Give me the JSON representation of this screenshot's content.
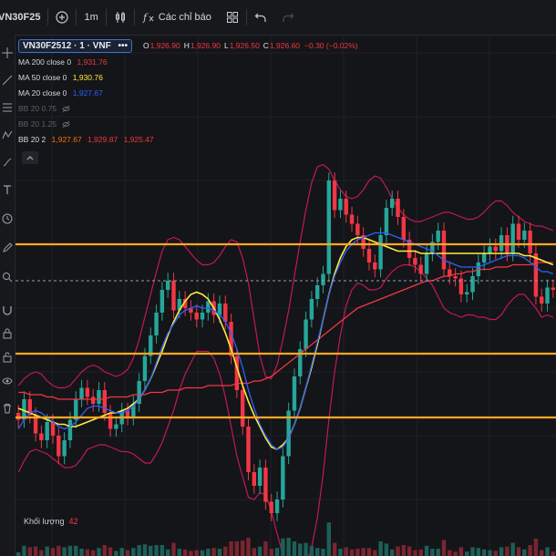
{
  "toolbar": {
    "symbol": "VN30F25",
    "interval": "1m",
    "indicators_label": "Các chỉ báo"
  },
  "legend": {
    "symbol_box": "VN30F2512 · 1 · VNF",
    "more": "•••",
    "ohlc": {
      "o_label": "O",
      "o": "1,926.90",
      "h_label": "H",
      "h": "1,926.90",
      "l_label": "L",
      "l": "1,926.50",
      "c_label": "C",
      "c": "1,926.60",
      "change": "−0.30 (−0.02%)"
    },
    "indicators": [
      {
        "label": "MA 200 close 0",
        "value": "1,931.76",
        "color": "#f23645",
        "dim": false
      },
      {
        "label": "MA 50 close 0",
        "value": "1,930.76",
        "color": "#ffeb3b",
        "dim": false
      },
      {
        "label": "MA 20 close 0",
        "value": "1,927.67",
        "color": "#2962ff",
        "dim": false
      },
      {
        "label": "BB 20 0.75",
        "value": "",
        "color": "",
        "dim": true
      },
      {
        "label": "BB 20 1.25",
        "value": "",
        "color": "",
        "dim": true
      }
    ],
    "bb_main": {
      "label": "BB 20 2",
      "v1": "1,927.67",
      "v2": "1,929.87",
      "v3": "1,925.47",
      "c1": "#ff6d00",
      "c2": "#f23645",
      "c3": "#f23645"
    }
  },
  "volume": {
    "label": "Khối lượng",
    "value": "42"
  },
  "colors": {
    "up": "#26a69a",
    "down": "#f23645",
    "ma200": "#f23645",
    "ma50": "#ffeb3b",
    "ma20": "#2962ff",
    "bb": "#c2185b",
    "hline": "#ffa726",
    "accent": "#2962ff"
  },
  "chart_data": {
    "type": "line",
    "title": "",
    "price_range_estimate": [
      1919,
      1934
    ],
    "horizontal_lines": [
      1930.8,
      1926.0,
      1923.2
    ],
    "last_price_line": 1929.2,
    "hline_labels": [
      "",
      "",
      ""
    ],
    "close": [
      1923.1,
      1924.0,
      1923.3,
      1922.5,
      1922.2,
      1923.0,
      1922.4,
      1921.5,
      1922.2,
      1923.1,
      1924.0,
      1924.5,
      1924.1,
      1923.8,
      1924.4,
      1923.4,
      1922.7,
      1922.9,
      1923.5,
      1923.2,
      1923.8,
      1924.8,
      1925.9,
      1926.8,
      1927.8,
      1928.8,
      1929.2,
      1927.9,
      1928.4,
      1928.0,
      1927.8,
      1927.5,
      1927.8,
      1928.3,
      1927.7,
      1928.2,
      1927.4,
      1925.9,
      1924.4,
      1922.8,
      1920.8,
      1920.2,
      1921.0,
      1919.5,
      1919.0,
      1919.6,
      1921.5,
      1923.5,
      1925.0,
      1926.2,
      1927.5,
      1928.4,
      1929.0,
      1929.5,
      1933.6,
      1932.3,
      1932.8,
      1932.1,
      1931.7,
      1931.2,
      1930.6,
      1930.0,
      1929.7,
      1931.2,
      1932.4,
      1932.8,
      1932.0,
      1931.0,
      1930.2,
      1929.9,
      1929.5,
      1930.4,
      1930.9,
      1931.4,
      1929.7,
      1929.4,
      1929.3,
      1928.6,
      1928.7,
      1929.4,
      1930.0,
      1930.4,
      1930.7,
      1930.5,
      1931.2,
      1930.4,
      1931.7,
      1931.0,
      1931.4,
      1930.4,
      1928.5,
      1928.2,
      1928.9,
      1928.8
    ],
    "ma20": [
      1922.7,
      1923.1,
      1923.4,
      1923.5,
      1923.4,
      1923.2,
      1923.0,
      1922.8,
      1922.7,
      1922.8,
      1923.0,
      1923.3,
      1923.6,
      1923.7,
      1923.7,
      1923.6,
      1923.5,
      1923.4,
      1923.4,
      1923.5,
      1923.7,
      1924.0,
      1924.4,
      1924.9,
      1925.6,
      1926.3,
      1926.9,
      1927.3,
      1927.7,
      1927.9,
      1928.0,
      1928.1,
      1928.0,
      1928.0,
      1927.9,
      1927.7,
      1927.4,
      1926.9,
      1926.2,
      1925.4,
      1924.4,
      1923.6,
      1922.9,
      1922.4,
      1922.0,
      1921.8,
      1921.9,
      1922.3,
      1922.9,
      1923.6,
      1924.5,
      1925.5,
      1926.5,
      1927.5,
      1928.6,
      1929.4,
      1930.0,
      1930.5,
      1930.8,
      1931.0,
      1931.1,
      1931.2,
      1931.3,
      1931.3,
      1931.3,
      1931.2,
      1931.1,
      1931.0,
      1930.9,
      1930.8,
      1930.7,
      1930.6,
      1930.5,
      1930.3,
      1930.1,
      1930.0,
      1929.9,
      1929.8,
      1929.8,
      1929.8,
      1929.8,
      1929.9,
      1930.0,
      1930.1,
      1930.2,
      1930.3,
      1930.3,
      1930.3,
      1930.2,
      1930.0,
      1929.8,
      1929.6,
      1929.6,
      1929.5
    ],
    "ma50": [
      1923.6,
      1923.5,
      1923.4,
      1923.3,
      1923.2,
      1923.1,
      1923.0,
      1922.9,
      1922.9,
      1922.8,
      1922.8,
      1922.9,
      1923.0,
      1923.1,
      1923.2,
      1923.3,
      1923.4,
      1923.4,
      1923.5,
      1923.6,
      1923.8,
      1924.0,
      1924.4,
      1924.9,
      1925.5,
      1926.1,
      1926.8,
      1927.4,
      1927.9,
      1928.3,
      1928.6,
      1928.7,
      1928.6,
      1928.4,
      1928.0,
      1927.5,
      1926.9,
      1926.2,
      1925.4,
      1924.6,
      1923.9,
      1923.3,
      1922.8,
      1922.3,
      1921.9,
      1921.8,
      1922.0,
      1922.3,
      1922.9,
      1923.6,
      1924.5,
      1925.4,
      1926.4,
      1927.5,
      1928.6,
      1929.5,
      1930.2,
      1930.7,
      1931.0,
      1931.1,
      1931.1,
      1931.0,
      1930.9,
      1930.8,
      1930.7,
      1930.6,
      1930.5,
      1930.5,
      1930.5,
      1930.5,
      1930.4,
      1930.4,
      1930.4,
      1930.4,
      1930.4,
      1930.4,
      1930.4,
      1930.4,
      1930.4,
      1930.4,
      1930.4,
      1930.4,
      1930.4,
      1930.4,
      1930.4,
      1930.4,
      1930.4,
      1930.4,
      1930.3,
      1930.3,
      1930.2,
      1930.1,
      1930.0,
      1929.9
    ],
    "ma200": [
      1924.3,
      1924.3,
      1924.2,
      1924.2,
      1924.2,
      1924.1,
      1924.1,
      1924.0,
      1924.0,
      1924.0,
      1924.0,
      1924.0,
      1924.0,
      1924.0,
      1924.0,
      1924.0,
      1924.1,
      1924.1,
      1924.1,
      1924.1,
      1924.2,
      1924.2,
      1924.2,
      1924.3,
      1924.3,
      1924.3,
      1924.4,
      1924.4,
      1924.4,
      1924.5,
      1924.5,
      1924.5,
      1924.5,
      1924.6,
      1924.6,
      1924.6,
      1924.6,
      1924.6,
      1924.7,
      1924.7,
      1924.7,
      1924.8,
      1924.8,
      1924.9,
      1925.0,
      1925.2,
      1925.4,
      1925.6,
      1925.8,
      1926.0,
      1926.2,
      1926.4,
      1926.6,
      1926.8,
      1927.0,
      1927.2,
      1927.4,
      1927.6,
      1927.8,
      1928.0,
      1928.1,
      1928.2,
      1928.3,
      1928.4,
      1928.5,
      1928.6,
      1928.7,
      1928.8,
      1928.9,
      1929.0,
      1929.1,
      1929.2,
      1929.2,
      1929.3,
      1929.4,
      1929.4,
      1929.5,
      1929.5,
      1929.6,
      1929.6,
      1929.7,
      1929.7,
      1929.7,
      1929.8,
      1929.8,
      1929.8,
      1929.9,
      1929.9,
      1929.9,
      1929.9,
      1930.0,
      1930.0,
      1930.0,
      1930.0
    ],
    "bb_upper": [
      1924.6,
      1924.9,
      1925.1,
      1925.2,
      1925.1,
      1924.8,
      1924.6,
      1924.5,
      1924.5,
      1924.6,
      1924.9,
      1925.2,
      1925.4,
      1925.5,
      1925.4,
      1925.2,
      1925.1,
      1925.0,
      1925.1,
      1925.3,
      1925.8,
      1926.6,
      1927.6,
      1928.6,
      1929.6,
      1930.5,
      1931.0,
      1931.1,
      1931.0,
      1930.7,
      1930.4,
      1930.1,
      1929.9,
      1929.9,
      1930.0,
      1930.3,
      1930.7,
      1931.0,
      1930.9,
      1930.2,
      1929.1,
      1927.5,
      1925.9,
      1925.0,
      1924.9,
      1925.5,
      1926.6,
      1927.9,
      1929.4,
      1930.9,
      1932.3,
      1933.5,
      1934.2,
      1934.3,
      1934.1,
      1933.6,
      1933.2,
      1932.9,
      1932.8,
      1932.9,
      1933.2,
      1933.6,
      1933.8,
      1933.7,
      1933.3,
      1932.8,
      1932.4,
      1932.1,
      1931.9,
      1931.8,
      1931.8,
      1931.9,
      1932.0,
      1932.1,
      1932.2,
      1932.2,
      1932.1,
      1932.0,
      1931.9,
      1931.9,
      1932.0,
      1932.2,
      1932.5,
      1932.7,
      1932.7,
      1932.5,
      1932.2,
      1932.0,
      1931.8,
      1931.7,
      1931.6,
      1931.6,
      1931.5,
      1931.4
    ],
    "bb_lower": [
      1920.8,
      1921.3,
      1921.7,
      1921.8,
      1921.7,
      1921.6,
      1921.4,
      1921.2,
      1921.0,
      1921.0,
      1921.1,
      1921.4,
      1921.8,
      1921.9,
      1922.0,
      1922.0,
      1921.9,
      1921.8,
      1921.7,
      1921.7,
      1921.6,
      1921.4,
      1921.2,
      1921.2,
      1921.6,
      1922.1,
      1922.8,
      1923.5,
      1924.4,
      1925.1,
      1925.6,
      1926.1,
      1926.1,
      1926.1,
      1925.8,
      1925.1,
      1924.1,
      1922.8,
      1921.5,
      1920.6,
      1919.7,
      1919.6,
      1919.9,
      1919.8,
      1919.1,
      1918.1,
      1917.2,
      1916.7,
      1916.4,
      1916.3,
      1916.7,
      1917.5,
      1918.8,
      1920.7,
      1923.1,
      1925.2,
      1926.8,
      1928.1,
      1928.8,
      1929.1,
      1929.0,
      1928.8,
      1928.8,
      1928.9,
      1929.3,
      1929.6,
      1929.8,
      1929.9,
      1929.9,
      1929.8,
      1929.6,
      1929.3,
      1929.0,
      1928.5,
      1928.0,
      1927.8,
      1927.7,
      1927.6,
      1927.7,
      1927.7,
      1927.6,
      1927.6,
      1927.5,
      1927.5,
      1927.7,
      1928.1,
      1928.4,
      1928.6,
      1928.6,
      1928.3,
      1928.0,
      1927.6,
      1927.7,
      1927.6
    ]
  }
}
